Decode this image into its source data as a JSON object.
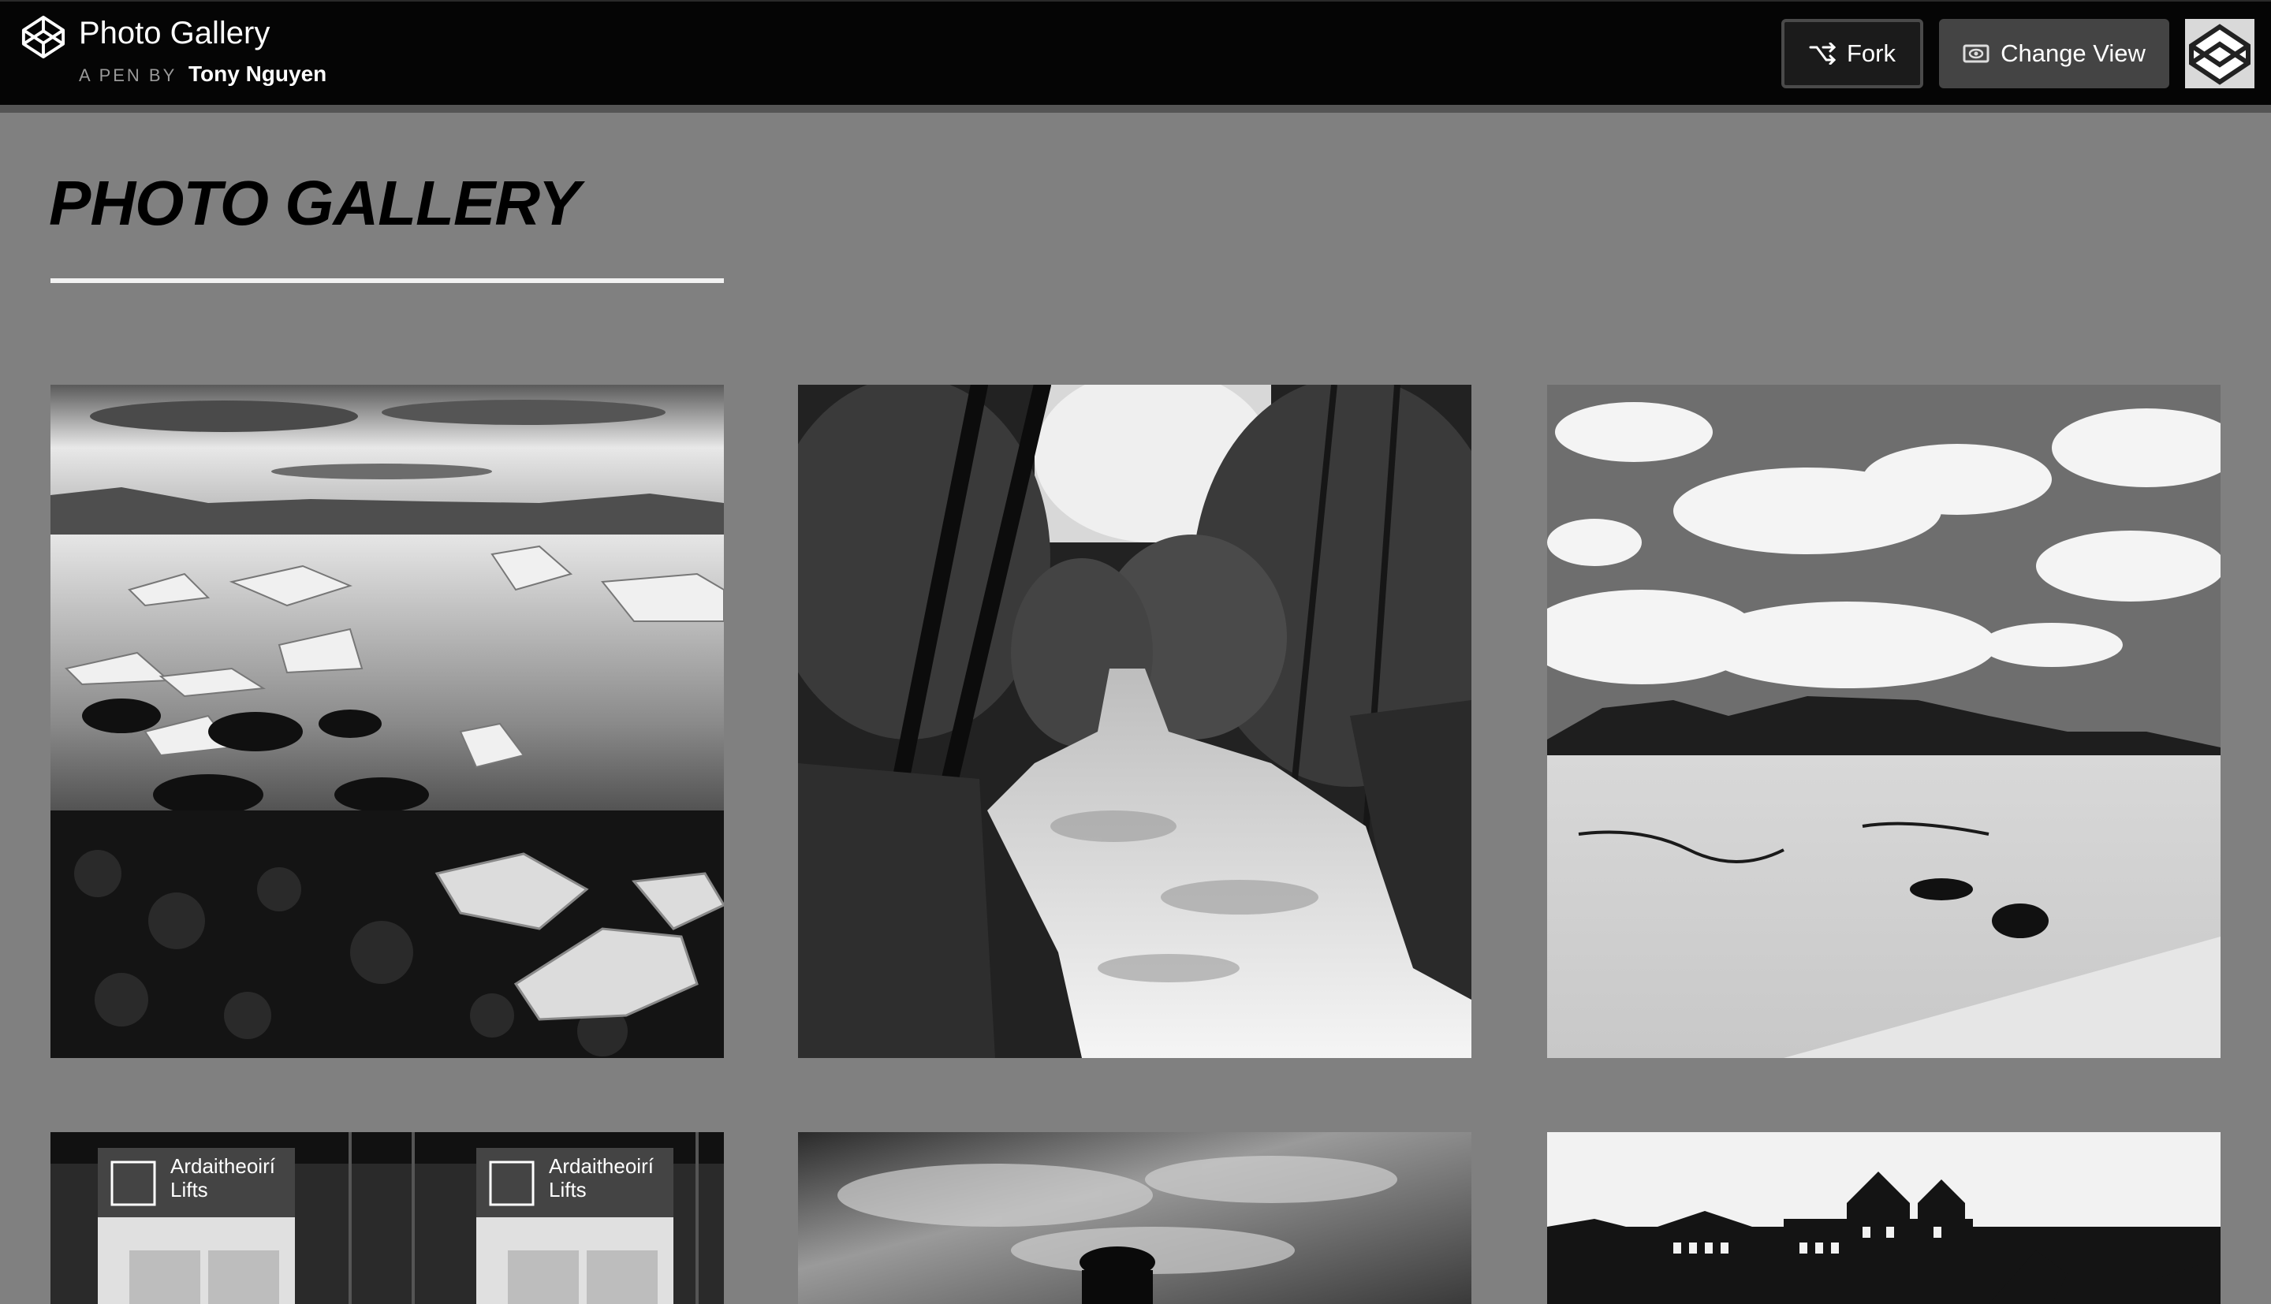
{
  "header": {
    "title": "Photo Gallery",
    "byline_prefix": "A PEN BY",
    "author": "Tony Nguyen",
    "fork_label": "Fork",
    "change_view_label": "Change View",
    "logo_icon": "codepen-logo-icon",
    "fork_icon": "fork-icon",
    "change_view_icon": "eye-icon"
  },
  "main": {
    "heading": "PHOTO GALLERY"
  },
  "gallery": {
    "photos": [
      {
        "subject": "glacier-lagoon"
      },
      {
        "subject": "forest-waterfall"
      },
      {
        "subject": "desert-dunes"
      },
      {
        "subject": "lifts-signs",
        "signs": [
          {
            "line1": "Ardaitheoirí",
            "line2": "Lifts"
          },
          {
            "line1": "Ardaitheoirí",
            "line2": "Lifts"
          }
        ]
      },
      {
        "subject": "cloudy-sky-silhouette"
      },
      {
        "subject": "castle-cyclist"
      }
    ]
  },
  "colors": {
    "background": "#808080",
    "topbar": "#050505",
    "rule": "#f2f2f2"
  }
}
